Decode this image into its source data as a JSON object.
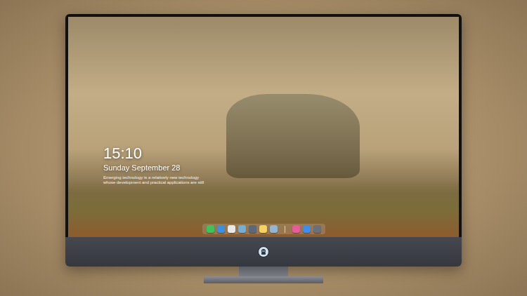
{
  "desktop": {
    "time": "15:10",
    "date": "Sunday September 28",
    "caption": [
      "Emerging technology is a relatively new technology",
      "whose development and practical applications are still"
    ]
  },
  "dock": [
    {
      "kind": "app",
      "color": "#3cc35a"
    },
    {
      "kind": "app",
      "color": "#3a8fe8"
    },
    {
      "kind": "app",
      "color": "#e8e8e8"
    },
    {
      "kind": "app",
      "color": "#6fb0d8"
    },
    {
      "kind": "app",
      "color": "#5b6a7a"
    },
    {
      "kind": "app",
      "color": "#f5d35a"
    },
    {
      "kind": "app",
      "color": "#8fb7d4"
    },
    {
      "kind": "separator",
      "color": "#d0d0d0"
    },
    {
      "kind": "app",
      "color": "#e85a9a"
    },
    {
      "kind": "app",
      "color": "#3b8df0"
    },
    {
      "kind": "app",
      "color": "#6a6f78"
    }
  ]
}
